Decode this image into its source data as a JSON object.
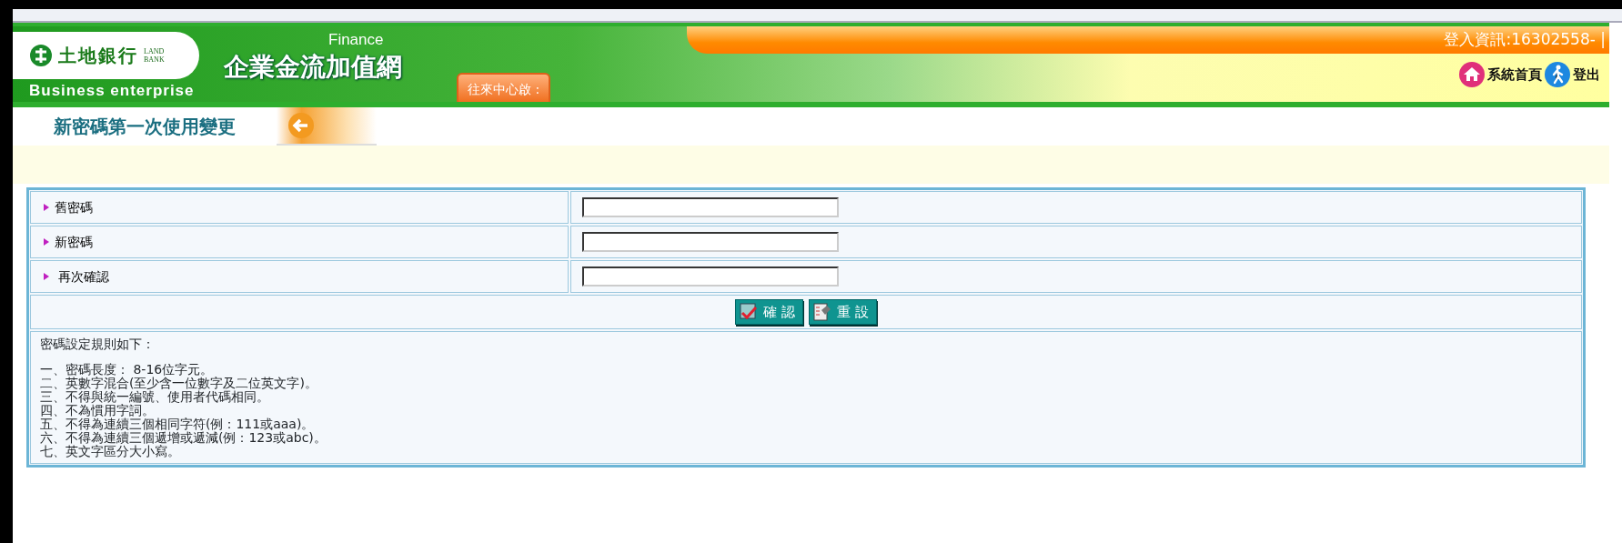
{
  "header": {
    "logo": {
      "name": "土地銀行",
      "english": [
        "LAND",
        "BANK"
      ],
      "tagline": "Business enterprise"
    },
    "product": {
      "label": "Finance",
      "title": "企業金流加值網"
    },
    "tab": {
      "label": "往來中心啟 :"
    },
    "login_info": "登入資訊:16302558- |",
    "links": [
      {
        "label": "系統首頁",
        "kind": "home"
      },
      {
        "label": "登出",
        "kind": "logout"
      }
    ]
  },
  "page_title": "新密碼第一次使用變更",
  "form": {
    "fields": [
      {
        "label": "舊密碼"
      },
      {
        "label": "新密碼"
      },
      {
        "label": " 再次確認"
      }
    ],
    "buttons": [
      {
        "label": "確 認",
        "kind": "confirm"
      },
      {
        "label": "重 設",
        "kind": "reset"
      }
    ],
    "rules_title": "密碼設定規則如下：",
    "rules": [
      "一、密碼長度： 8-16位字元。",
      "二、英數字混合(至少含一位數字及二位英文字)。",
      "三、不得與統一編號、使用者代碼相同。",
      "四、不為慣用字詞。",
      "五、不得為連續三個相同字符(例：111或aaa)。",
      "六、不得為連續三個遞增或遞減(例：123或abc)。",
      "七、英文字區分大小寫。"
    ]
  }
}
